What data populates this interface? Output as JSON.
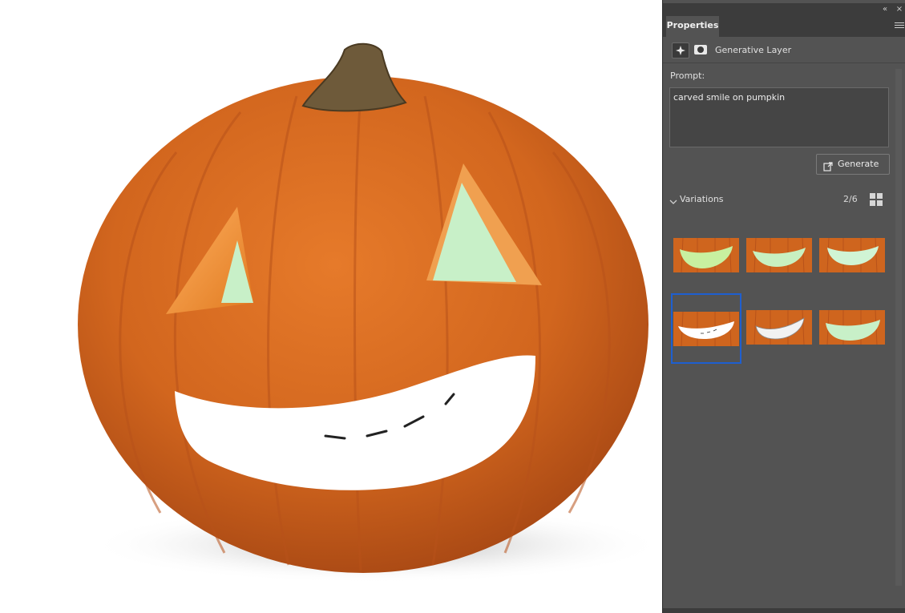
{
  "panel": {
    "title": "Properties",
    "layer_type": "Generative Layer",
    "prompt_label": "Prompt:",
    "prompt_value": "carved smile on pumpkin",
    "generate_label": "Generate",
    "variations_label": "Variations",
    "variations_count": "2/6",
    "selected_variation": 4
  },
  "colors": {
    "panel_bg": "#535353",
    "tabbar_bg": "#3c3c3c",
    "selection": "#1e5fd0",
    "pumpkin": "#d2661e",
    "pumpkin_dark": "#a84814",
    "carve_glow": "#c8f0c8"
  },
  "icons": {
    "collapse": "double-chevron-left-icon",
    "close": "close-icon",
    "panel_menu": "hamburger-menu-icon",
    "generative": "sparkle-icon",
    "mask": "mask-icon",
    "generate": "generate-icon",
    "variations_toggle": "chevron-down-icon",
    "grid_view": "grid-view-icon"
  }
}
